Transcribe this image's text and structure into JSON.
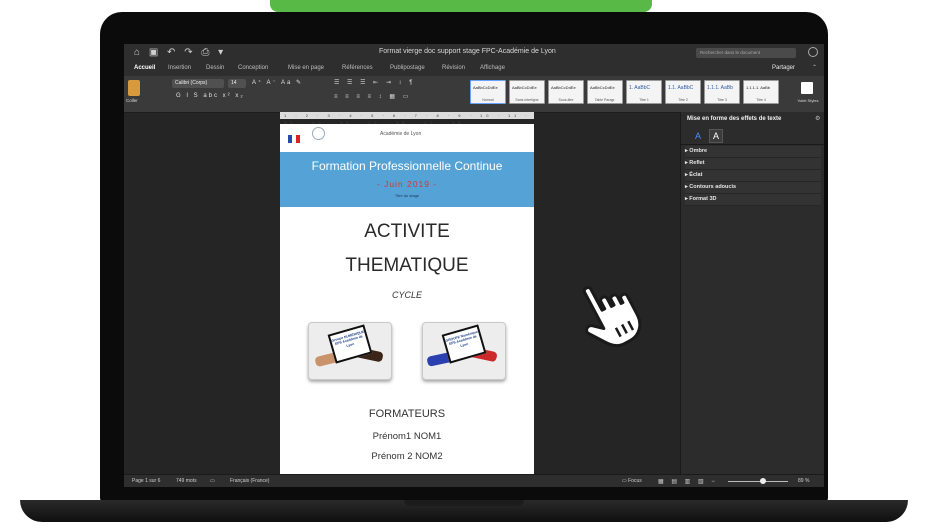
{
  "window": {
    "title": "Format vierge doc support stage FPC-Académie de Lyon",
    "search_placeholder": "Rechercher dans le document"
  },
  "quick_access": {
    "icons": [
      "home-icon",
      "save-icon",
      "undo-icon",
      "redo-icon",
      "print-icon"
    ],
    "glyphs": "⌂ ▣ ↶ ↷ ⎙ ▾"
  },
  "tabs": [
    {
      "label": "Accueil",
      "active": true
    },
    {
      "label": "Insertion"
    },
    {
      "label": "Dessin"
    },
    {
      "label": "Conception"
    },
    {
      "label": "Mise en page"
    },
    {
      "label": "Références"
    },
    {
      "label": "Publipostage"
    },
    {
      "label": "Révision"
    },
    {
      "label": "Affichage"
    }
  ],
  "share_label": "Partager",
  "ribbon": {
    "paste_label": "Coller",
    "font_name": "Calibri (Corps)",
    "font_size": "14",
    "format_glyphs": "G I S abc x² x₂",
    "font_glyphs": "A⁺ A⁻ Aa ✎",
    "para_glyphs": "☰ ☰ ☰ ⇤ ⇥ ↕ ¶",
    "align_glyphs": "≡ ≡ ≡ ≡ ↕ ▦ ▭",
    "styles": [
      {
        "sample": "AaBbCcDdEe",
        "name": "Normal",
        "selected": true
      },
      {
        "sample": "AaBbCcDdEe",
        "name": "Sans interligne"
      },
      {
        "sample": "AaBbCcDdEe",
        "name": "Sous-titre"
      },
      {
        "sample": "AaBbCcDdEe",
        "name": "Table Paragr."
      },
      {
        "sample": "1. AaBbC",
        "name": "Titre 1"
      },
      {
        "sample": "1.1. AaBbC",
        "name": "Titre 2"
      },
      {
        "sample": "1.1.1. AaBb",
        "name": "Titre 3"
      },
      {
        "sample": "1.1.1.1. AaBb",
        "name": "Titre 4"
      }
    ],
    "styles_pane_label": "Volet Styles"
  },
  "ruler": {
    "ticks": "1 · 2 · 3 · 4 · 5 · 6 · 7 · 8 · 9 · 10 · 11 · 12 · 13 · 14 · 15 · 16 · 17 · 18"
  },
  "document": {
    "academie": "Académie de Lyon",
    "band_title": "Formation Professionnelle Continue",
    "band_date": "- Juin 2019 -",
    "band_small": "Titre du stage",
    "activite": "ACTIVITE",
    "thematique": "THEMATIQUE",
    "cycle": "CYCLE",
    "tablet1_text": "Groupe NUMÉRIQUE EPS Académie de Lyon",
    "tablet2_text": "GROUPE Numérique EPS Académie de Lyon",
    "formateurs": "FORMATEURS",
    "prenom1": "Prénom1 NOM1",
    "prenom2": "Prénom 2 NOM2"
  },
  "right_panel": {
    "title": "Mise en forme des effets de texte",
    "tab1_glyph": "A",
    "tab2_glyph": "A",
    "items": [
      "Ombre",
      "Reflet",
      "Éclat",
      "Contours adoucis",
      "Format 3D"
    ]
  },
  "statusbar": {
    "page": "Page 1 sur 6",
    "words": "749 mots",
    "language": "Français (France)",
    "focus": "Focus",
    "zoom": "89 %"
  },
  "colors": {
    "band": "#55a2d6",
    "band_date": "#d03a3a",
    "accent_tab": "#58b947"
  }
}
